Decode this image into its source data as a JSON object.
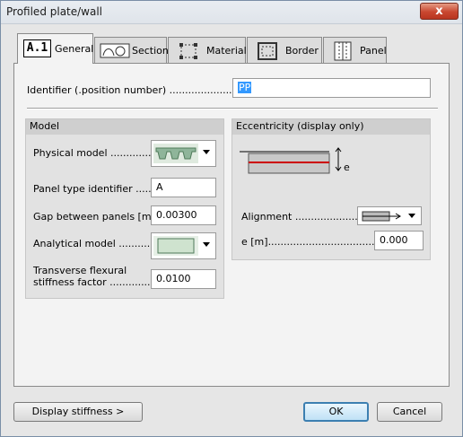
{
  "window": {
    "title": "Profiled plate/wall",
    "close_glyph": "x"
  },
  "tabs": [
    {
      "label": "General",
      "badge": "A.1",
      "icon": "a1-icon",
      "active": true
    },
    {
      "label": "Section",
      "icon": "section-icon",
      "active": false
    },
    {
      "label": "Material",
      "icon": "material-icon",
      "active": false
    },
    {
      "label": "Border",
      "icon": "border-icon",
      "active": false
    },
    {
      "label": "Panel",
      "icon": "panel-icon",
      "active": false
    }
  ],
  "identifier": {
    "label": "Identifier (.position number) ......................",
    "value": "PP"
  },
  "model": {
    "header": "Model",
    "physical_model_label": "Physical model .............",
    "panel_type_label": "Panel type identifier ........",
    "panel_type_value": "A",
    "gap_label": "Gap between panels [m] ..",
    "gap_value": "0.00300",
    "analytical_model_label": "Analytical model .............",
    "transverse_label_line1": "Transverse flexural",
    "transverse_label_line2": "stiffness factor ..............",
    "transverse_value": "0.0100"
  },
  "eccentricity": {
    "header": "Eccentricity (display only)",
    "diagram_label": "e",
    "alignment_label": "Alignment ......................",
    "e_label": "e [m]...................................",
    "e_value": "0.000"
  },
  "buttons": {
    "display_stiffness": "Display stiffness >",
    "ok": "OK",
    "cancel": "Cancel"
  },
  "colors": {
    "eccentricity_line": "#cc0000",
    "model_fill": "#cfe3cf",
    "model_stroke": "#4f7a5a",
    "close_button": "#c8462f"
  }
}
